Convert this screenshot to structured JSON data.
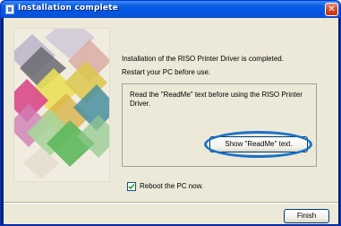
{
  "window": {
    "title": "Installation complete",
    "close_glyph": "✕"
  },
  "messages": {
    "line1": "Installation of the RISO Printer Driver is completed.",
    "line2": "Restart your PC before use."
  },
  "readme_box": {
    "note": "Read the \"ReadMe\" text before using the RISO Printer Driver.",
    "button_label": "Show \"ReadMe\" text."
  },
  "reboot": {
    "label": "Reboot the PC now.",
    "checked": true
  },
  "footer": {
    "finish_label": "Finish"
  },
  "colors": {
    "titlebar": "#0a5ee0",
    "dialog_bg": "#ece9d8",
    "highlight_ring": "#1a72c8"
  },
  "icons": {
    "app": "installer-icon",
    "close": "close-icon",
    "check": "check-icon"
  }
}
